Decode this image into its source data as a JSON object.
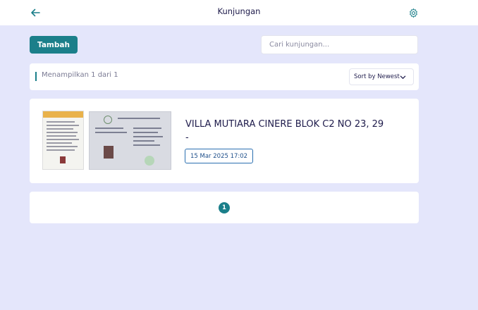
{
  "header": {
    "title": "Kunjungan",
    "back_icon": "arrow-left-icon",
    "settings_icon": "gear-icon"
  },
  "toolbar": {
    "add_label": "Tambah",
    "search_placeholder": "Cari kunjungan...",
    "search_value": ""
  },
  "info": {
    "count_text": "Menampilkan 1 dari 1",
    "sort_label": "Sort by Newest",
    "sort_icon": "chevron-down-icon"
  },
  "visits": [
    {
      "address": "VILLA MUTIARA CINERE BLOK C2 NO 23, 29 -",
      "date": "15 Mar 2025 17:02"
    }
  ],
  "pagination": {
    "current_page": "1"
  },
  "colors": {
    "accent": "#1b7f8a",
    "background": "#e4e6fb",
    "text": "#1e1b4b"
  }
}
